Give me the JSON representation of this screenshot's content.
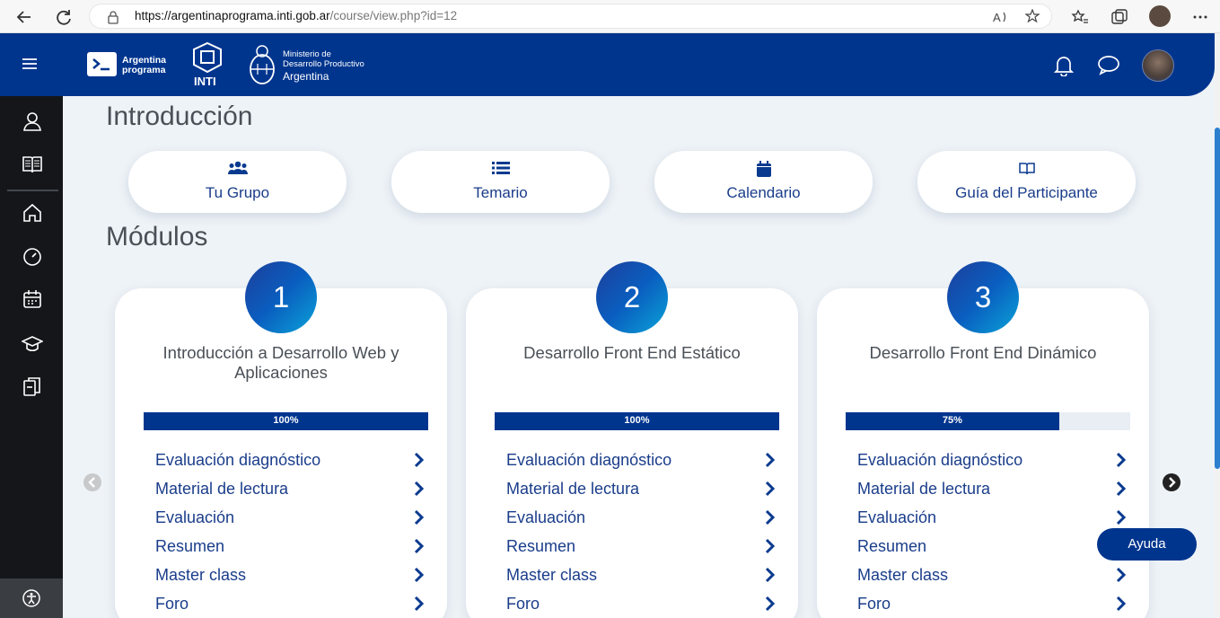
{
  "browser": {
    "url_host": "https://argentinaprograma.inti.gob.ar",
    "url_path": "/course/view.php?id=12"
  },
  "header": {
    "logo1_line1": "Argentina",
    "logo1_line2": "programa",
    "logo2_text": "INTI",
    "logo3_line1": "Ministerio de",
    "logo3_line2": "Desarrollo Productivo",
    "logo3_line3": "Argentina"
  },
  "intro": {
    "heading": "Introducción",
    "links": [
      {
        "label": "Tu Grupo",
        "icon": "users-icon"
      },
      {
        "label": "Temario",
        "icon": "list-icon"
      },
      {
        "label": "Calendario",
        "icon": "calendar-icon"
      },
      {
        "label": "Guía del Participante",
        "icon": "book-icon"
      }
    ]
  },
  "modules": {
    "heading": "Módulos",
    "cards": [
      {
        "number": "1",
        "title": "Introducción a Desarrollo Web y Aplicaciones",
        "progress": 100,
        "progress_label": "100%",
        "items": [
          "Evaluación diagnóstico",
          "Material de lectura",
          "Evaluación",
          "Resumen",
          "Master class",
          "Foro"
        ]
      },
      {
        "number": "2",
        "title": "Desarrollo Front End Estático",
        "progress": 100,
        "progress_label": "100%",
        "items": [
          "Evaluación diagnóstico",
          "Material de lectura",
          "Evaluación",
          "Resumen",
          "Master class",
          "Foro"
        ]
      },
      {
        "number": "3",
        "title": "Desarrollo Front End Dinámico",
        "progress": 75,
        "progress_label": "75%",
        "items": [
          "Evaluación diagnóstico",
          "Material de lectura",
          "Evaluación",
          "Resumen",
          "Master class",
          "Foro"
        ]
      }
    ]
  },
  "help_button": "Ayuda",
  "colors": {
    "brand": "#00358e",
    "text": "#1a3d8a"
  }
}
